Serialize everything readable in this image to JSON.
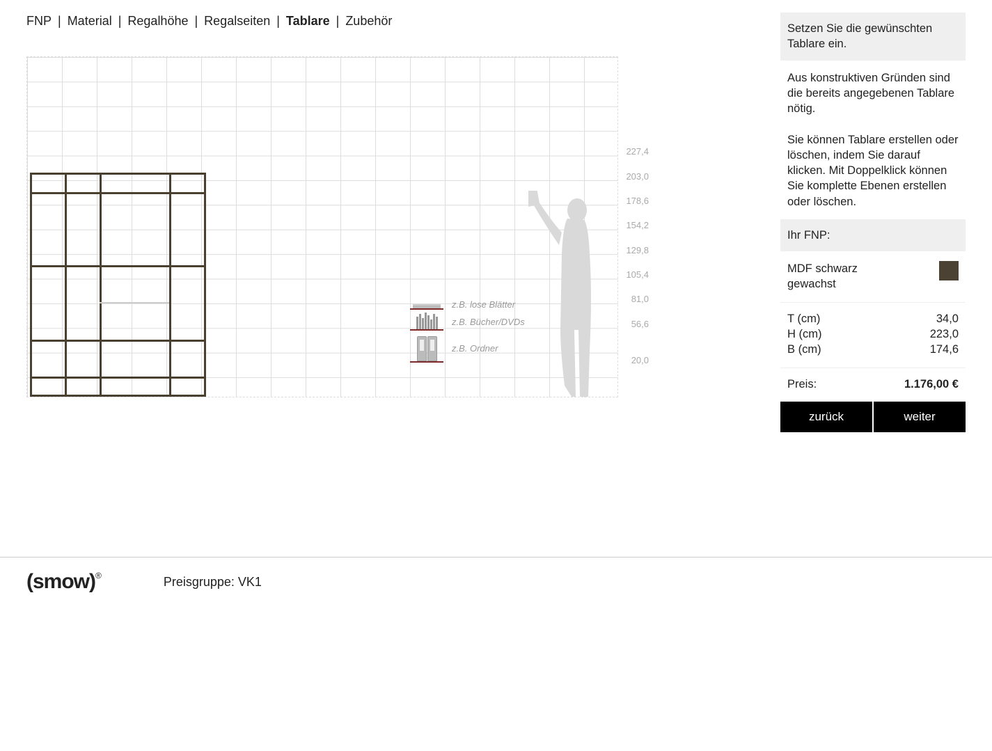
{
  "breadcrumbs": {
    "items": [
      "FNP",
      "Material",
      "Regalhöhe",
      "Regalseiten",
      "Tablare",
      "Zubehör"
    ],
    "active_index": 4
  },
  "heights": [
    "227,4",
    "203,0",
    "178,6",
    "154,2",
    "129,8",
    "105,4",
    "81,0",
    "56,6",
    "20,0"
  ],
  "legend": {
    "loose": "z.B. lose Blätter",
    "books": "z.B. Bücher/DVDs",
    "binders": "z.B. Ordner"
  },
  "sidebar": {
    "intro": "Setzen Sie die gewünschten Tablare ein.",
    "info1": "Aus konstruktiven Gründen sind die bereits angegebenen Tablare nötig.",
    "info2": "Sie können Tablare erstellen oder löschen, indem Sie darauf klicken. Mit Doppelklick können Sie komplette Ebenen erstellen oder löschen.",
    "your_fnp": "Ihr FNP:",
    "material": "MDF schwarz gewachst",
    "swatch_color": "#4c4233",
    "dims": {
      "t_label": "T (cm)",
      "t_value": "34,0",
      "h_label": "H (cm)",
      "h_value": "223,0",
      "b_label": "B (cm)",
      "b_value": "174,6"
    },
    "price_label": "Preis:",
    "price_value": "1.176,00 €",
    "back": "zurück",
    "next": "weiter"
  },
  "footer": {
    "logo": "(smow)",
    "pricegroup": "Preisgruppe: VK1"
  }
}
